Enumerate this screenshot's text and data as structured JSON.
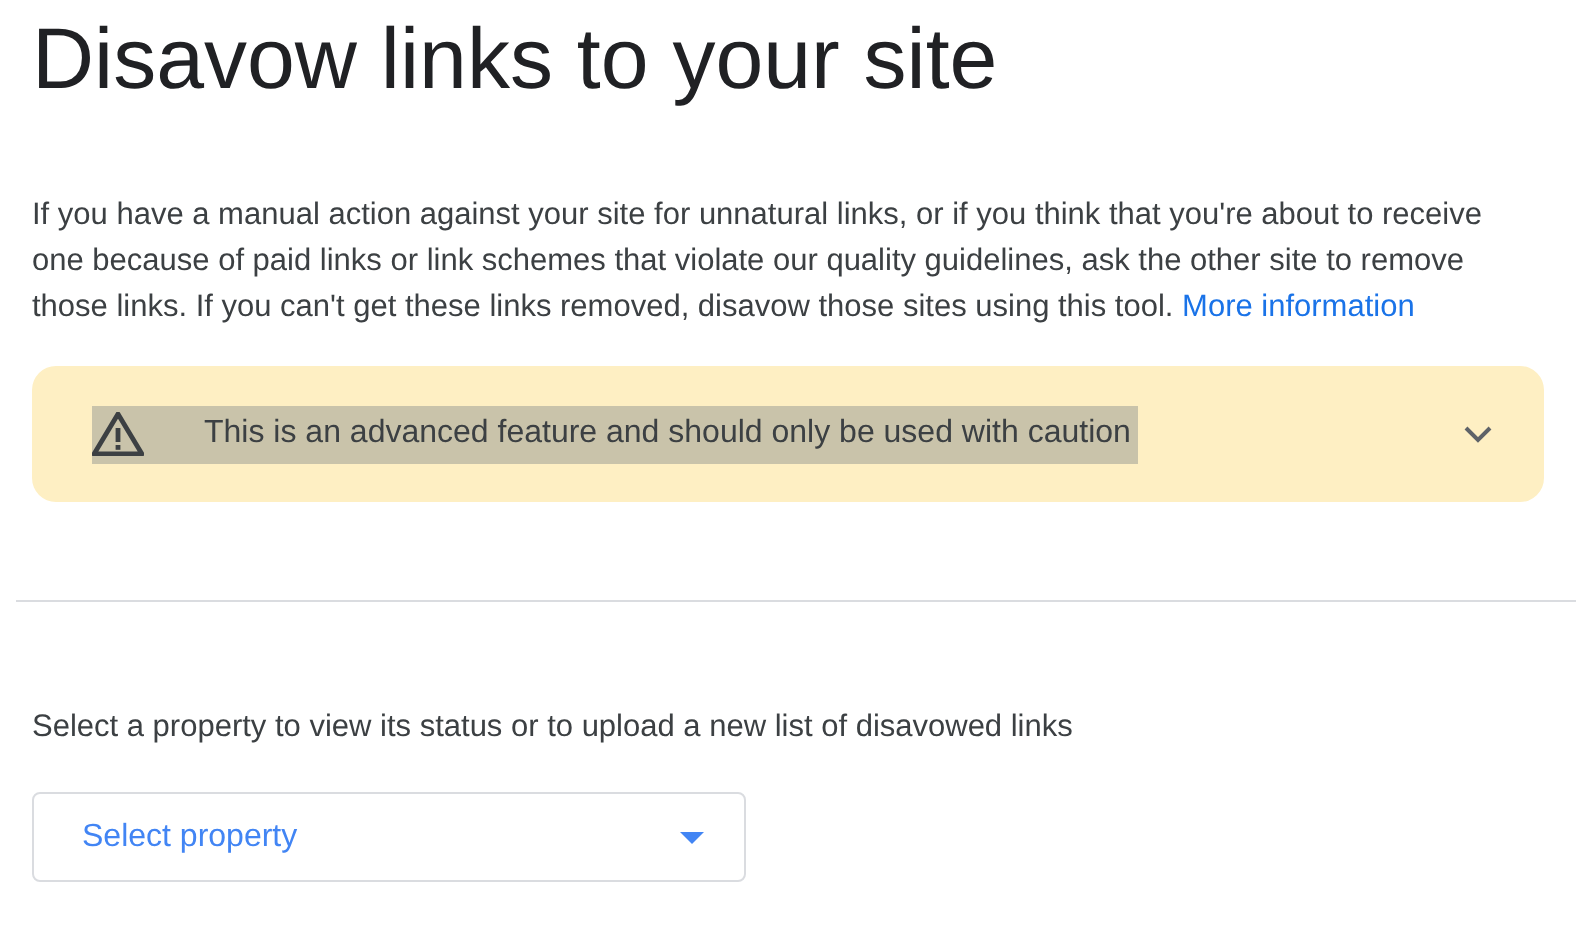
{
  "title": "Disavow links to your site",
  "intro": {
    "text": "If you have a manual action against your site for unnatural links, or if you think that you're about to receive one because of paid links or link schemes that violate our quality guidelines, ask the other site to remove those links. If you can't get these links removed, disavow those sites using this tool.",
    "link": "More information"
  },
  "warning": {
    "text": "This is an advanced feature and should only be used with caution",
    "text_selected": true,
    "expanded": false
  },
  "property_prompt": "Select a property to view its status or to upload a new list of disavowed links",
  "property_select": {
    "placeholder": "Select property"
  }
}
